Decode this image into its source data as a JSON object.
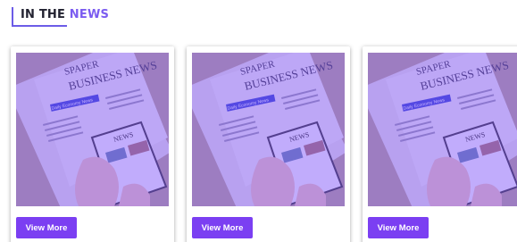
{
  "section": {
    "heading_prefix": "IN THE ",
    "heading_accent": "NEWS"
  },
  "cards": [
    {
      "image_alt": "newspaper-business-news",
      "paper_title_top": "SPAPER",
      "paper_title": "BUSINESS NEWS",
      "paper_label": "Daily Economy News",
      "tablet_title": "NEWS",
      "button_label": "View More"
    },
    {
      "image_alt": "newspaper-business-news",
      "paper_title_top": "SPAPER",
      "paper_title": "BUSINESS NEWS",
      "paper_label": "Daily Economy News",
      "tablet_title": "NEWS",
      "button_label": "View More"
    },
    {
      "image_alt": "newspaper-business-news",
      "paper_title_top": "SPAPER",
      "paper_title": "BUSINESS NEWS",
      "paper_label": "Daily Economy News",
      "tablet_title": "NEWS",
      "button_label": "View More"
    }
  ],
  "colors": {
    "accent": "#7b5cf0",
    "button": "#7b3ff2",
    "overlay": "#7c4dff"
  }
}
